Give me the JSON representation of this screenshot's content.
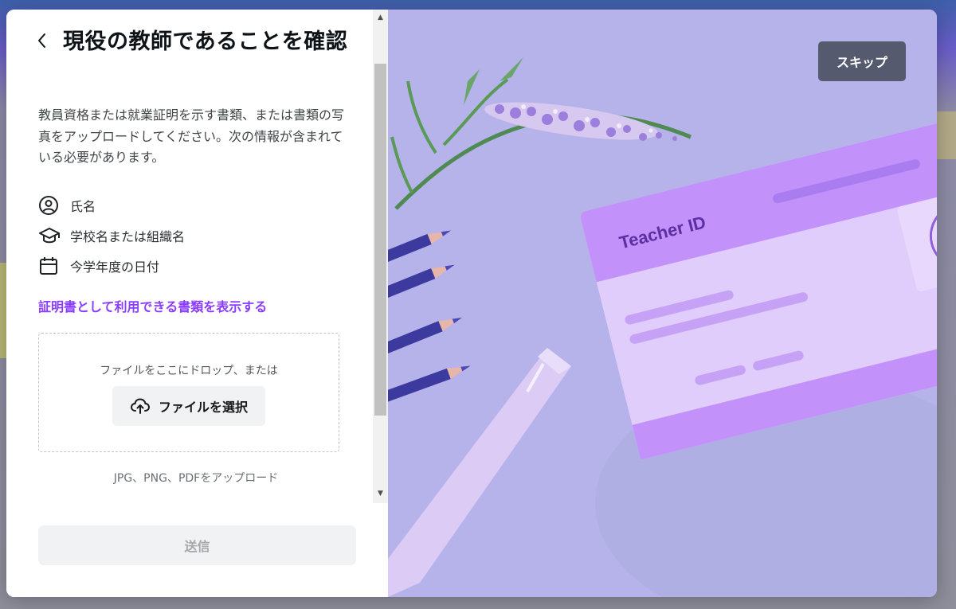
{
  "dialog": {
    "title": "現役の教師であることを確認",
    "description": "教員資格または就業証明を示す書類、または書類の写真をアップロードしてください。次の情報が含まれている必要があります。",
    "requirements": [
      {
        "icon": "user-circle-icon",
        "label": "氏名"
      },
      {
        "icon": "graduation-cap-icon",
        "label": "学校名または組織名"
      },
      {
        "icon": "calendar-icon",
        "label": "今学年度の日付"
      }
    ],
    "documents_link": "証明書として利用できる書類を表示する",
    "upload": {
      "drop_text": "ファイルをここにドロップ、または",
      "choose_file_label": "ファイルを選択",
      "formats_text": "JPG、PNG、PDFをアップロード"
    },
    "submit_label": "送信"
  },
  "illustration": {
    "skip_label": "スキップ",
    "card_text": "Teacher ID"
  },
  "colors": {
    "accent": "#8b3dff",
    "illustration_bg": "#b5b3ea",
    "skip_bg": "#565a6f"
  }
}
